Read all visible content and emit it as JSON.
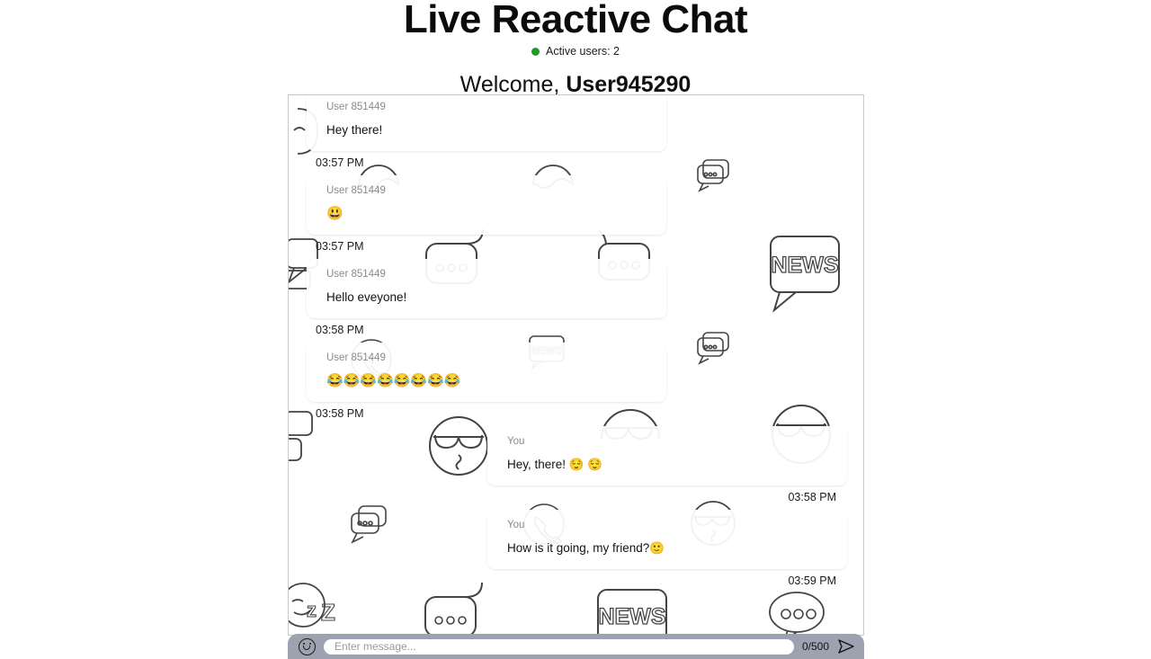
{
  "header": {
    "app_title": "Live Reactive Chat",
    "status_icon": "green-dot",
    "active_users_label": "Active users: 2",
    "welcome_prefix": "Welcome, ",
    "welcome_username": "User945290",
    "accent_green": "#1f9a27"
  },
  "chat": {
    "messages": [
      {
        "side": "left",
        "sender": "User 851449",
        "text": "Hey there!",
        "time": "03:57 PM",
        "clipped_top": true
      },
      {
        "side": "left",
        "sender": "User 851449",
        "text": "😃",
        "time": "03:57 PM",
        "emoji_only": true
      },
      {
        "side": "left",
        "sender": "User 851449",
        "text": "Hello eveyone!",
        "time": "03:58 PM"
      },
      {
        "side": "left",
        "sender": "User 851449",
        "text": "😂😂😂😂😂😂😂😂",
        "time": "03:58 PM",
        "emoji_only": true
      },
      {
        "side": "right",
        "sender": "You",
        "text": "Hey, there! 😌 😌",
        "time": "03:58 PM"
      },
      {
        "side": "right",
        "sender": "You",
        "text": "How is it going, my friend?🙂",
        "time": "03:59 PM"
      }
    ]
  },
  "composer": {
    "emoji_button_icon": "smiley-face-icon",
    "input_value": "",
    "input_placeholder": "Enter message...",
    "char_counter": "0/500",
    "send_button_icon": "paper-plane-icon"
  },
  "background": {
    "pattern_name": "chat-doodle-pattern",
    "doodle_icons": [
      "speech-bubble-pair-icon",
      "news-speech-bubble-icon",
      "phone-call-icon",
      "sunglasses-face-icon",
      "sleeping-face-icon",
      "dots-chat-bubble-icon"
    ]
  }
}
